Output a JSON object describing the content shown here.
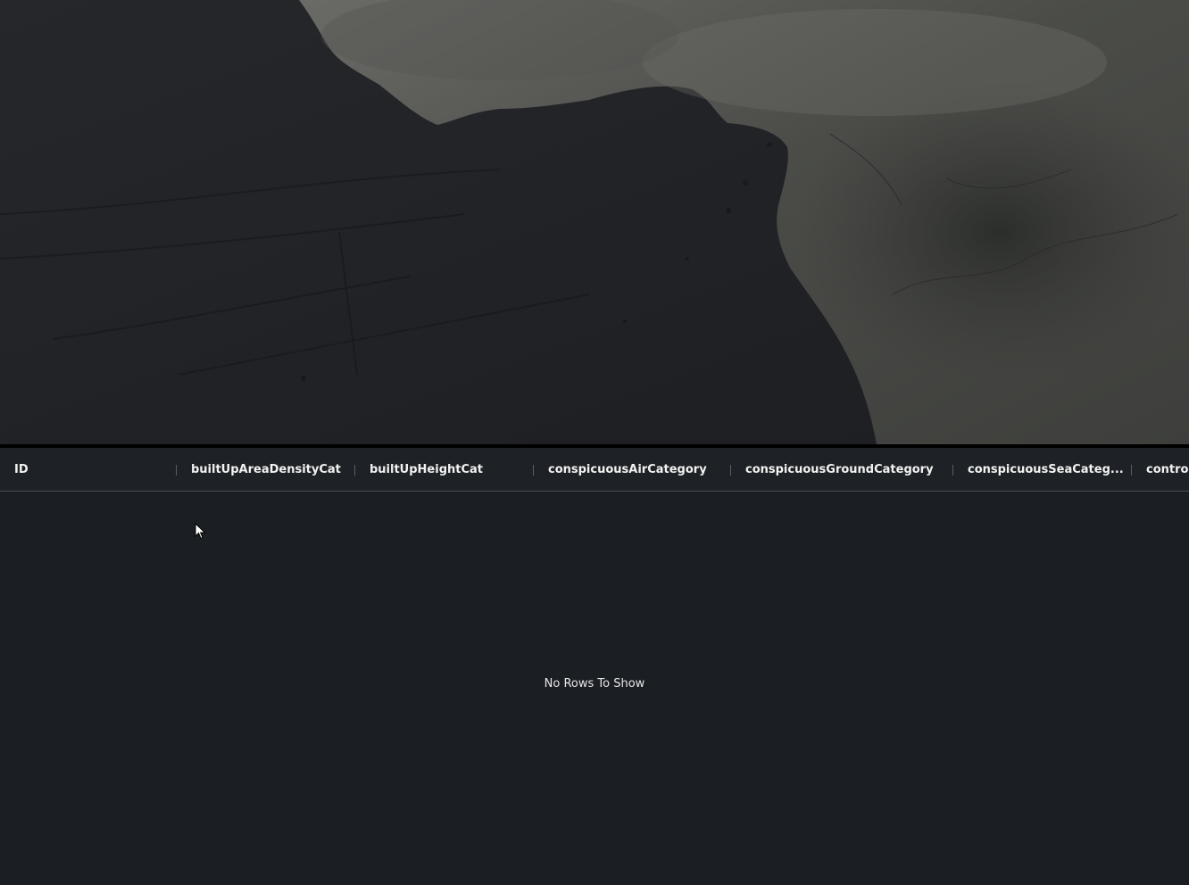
{
  "grid": {
    "columns": [
      {
        "label": "ID"
      },
      {
        "label": "builtUpAreaDensityCat"
      },
      {
        "label": "builtUpHeightCat"
      },
      {
        "label": "conspicuousAirCategory"
      },
      {
        "label": "conspicuousGroundCategory"
      },
      {
        "label": "conspicuousSeaCateg..."
      },
      {
        "label": "controll"
      }
    ],
    "overlay_text": "No Rows To Show"
  },
  "icons": {
    "cursor": "mouse-pointer-icon"
  },
  "colors": {
    "ocean": "#1f2125",
    "land": "#4a4a48",
    "grid_background": "#1b1e22",
    "header_text": "#f2f2f2"
  }
}
